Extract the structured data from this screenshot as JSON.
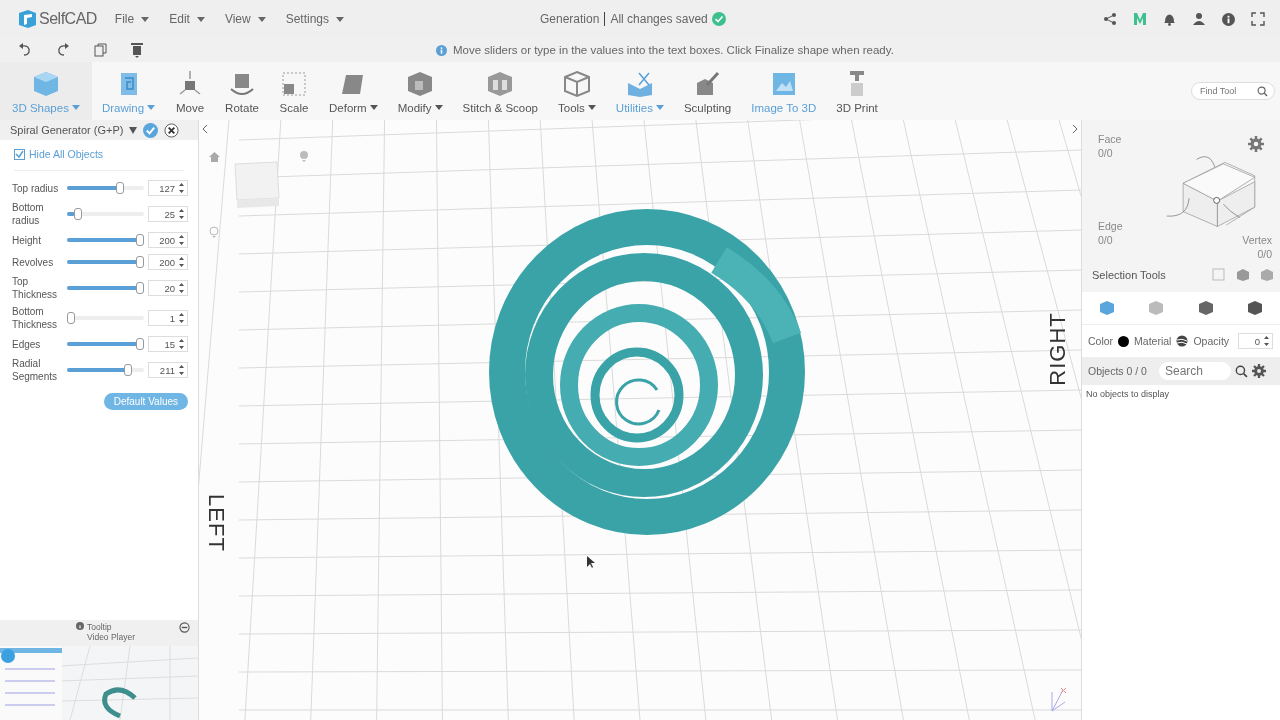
{
  "app": {
    "name": "SelfCAD"
  },
  "menu": [
    {
      "label": "File"
    },
    {
      "label": "Edit"
    },
    {
      "label": "View"
    },
    {
      "label": "Settings"
    }
  ],
  "status": {
    "project": "Generation",
    "saved": "All changes saved"
  },
  "hint": "Move sliders or type in the values into the text boxes. Click Finalize shape when ready.",
  "toolbar": [
    {
      "label": "3D Shapes",
      "selected": true,
      "highlighted": true,
      "has_menu": true
    },
    {
      "label": "Drawing",
      "selected": false,
      "highlighted": true,
      "has_menu": true
    },
    {
      "label": "Move",
      "selected": false,
      "highlighted": false,
      "has_menu": false
    },
    {
      "label": "Rotate",
      "selected": false,
      "highlighted": false,
      "has_menu": false
    },
    {
      "label": "Scale",
      "selected": false,
      "highlighted": false,
      "has_menu": false
    },
    {
      "label": "Deform",
      "selected": false,
      "highlighted": false,
      "has_menu": true
    },
    {
      "label": "Modify",
      "selected": false,
      "highlighted": false,
      "has_menu": true
    },
    {
      "label": "Stitch & Scoop",
      "selected": false,
      "highlighted": false,
      "has_menu": false
    },
    {
      "label": "Tools",
      "selected": false,
      "highlighted": false,
      "has_menu": true
    },
    {
      "label": "Utilities",
      "selected": false,
      "highlighted": true,
      "has_menu": true
    },
    {
      "label": "Sculpting",
      "selected": false,
      "highlighted": false,
      "has_menu": false
    },
    {
      "label": "Image To 3D",
      "selected": false,
      "highlighted": true,
      "has_menu": false
    },
    {
      "label": "3D Print",
      "selected": false,
      "highlighted": false,
      "has_menu": false
    }
  ],
  "find_tool": {
    "placeholder": "Find Tool"
  },
  "generator": {
    "title": "Spiral Generator (G+P)",
    "hide_all": {
      "label": "Hide All Objects",
      "checked": true
    },
    "params": [
      {
        "label": "Top radius",
        "level": 0.71,
        "value": "127"
      },
      {
        "label": "Bottom radius",
        "level": 0.1,
        "value": "25"
      },
      {
        "label": "Height",
        "level": 1,
        "value": "200"
      },
      {
        "label": "Revolves",
        "level": 1,
        "value": "200"
      },
      {
        "label": "Top Thickness",
        "level": 1,
        "value": "20"
      },
      {
        "label": "Bottom Thickness",
        "level": 0,
        "value": "1"
      },
      {
        "label": "Edges",
        "level": 1,
        "value": "15"
      },
      {
        "label": "Radial Segments",
        "level": 0.83,
        "value": "211"
      }
    ],
    "default_button": "Default Values"
  },
  "tooltip": {
    "title": "Tooltip",
    "subtitle": "Video Player"
  },
  "viewport": {
    "right_label": "RIGHT",
    "left_label": "LEFT"
  },
  "selection": {
    "face": {
      "label": "Face",
      "count": "0/0"
    },
    "edge": {
      "label": "Edge",
      "count": "0/0"
    },
    "vertex": {
      "label": "Vertex",
      "count": "0/0"
    },
    "tools_label": "Selection Tools"
  },
  "view_modes": [
    {
      "selected": true
    },
    {
      "selected": false
    },
    {
      "selected": false
    },
    {
      "selected": false
    }
  ],
  "properties": {
    "color_label": "Color",
    "color": "#000000",
    "material_label": "Material",
    "opacity_label": "Opacity",
    "opacity": "0"
  },
  "objects": {
    "label": "Objects 0 / 0",
    "search_placeholder": "Search",
    "empty": "No objects to display"
  }
}
